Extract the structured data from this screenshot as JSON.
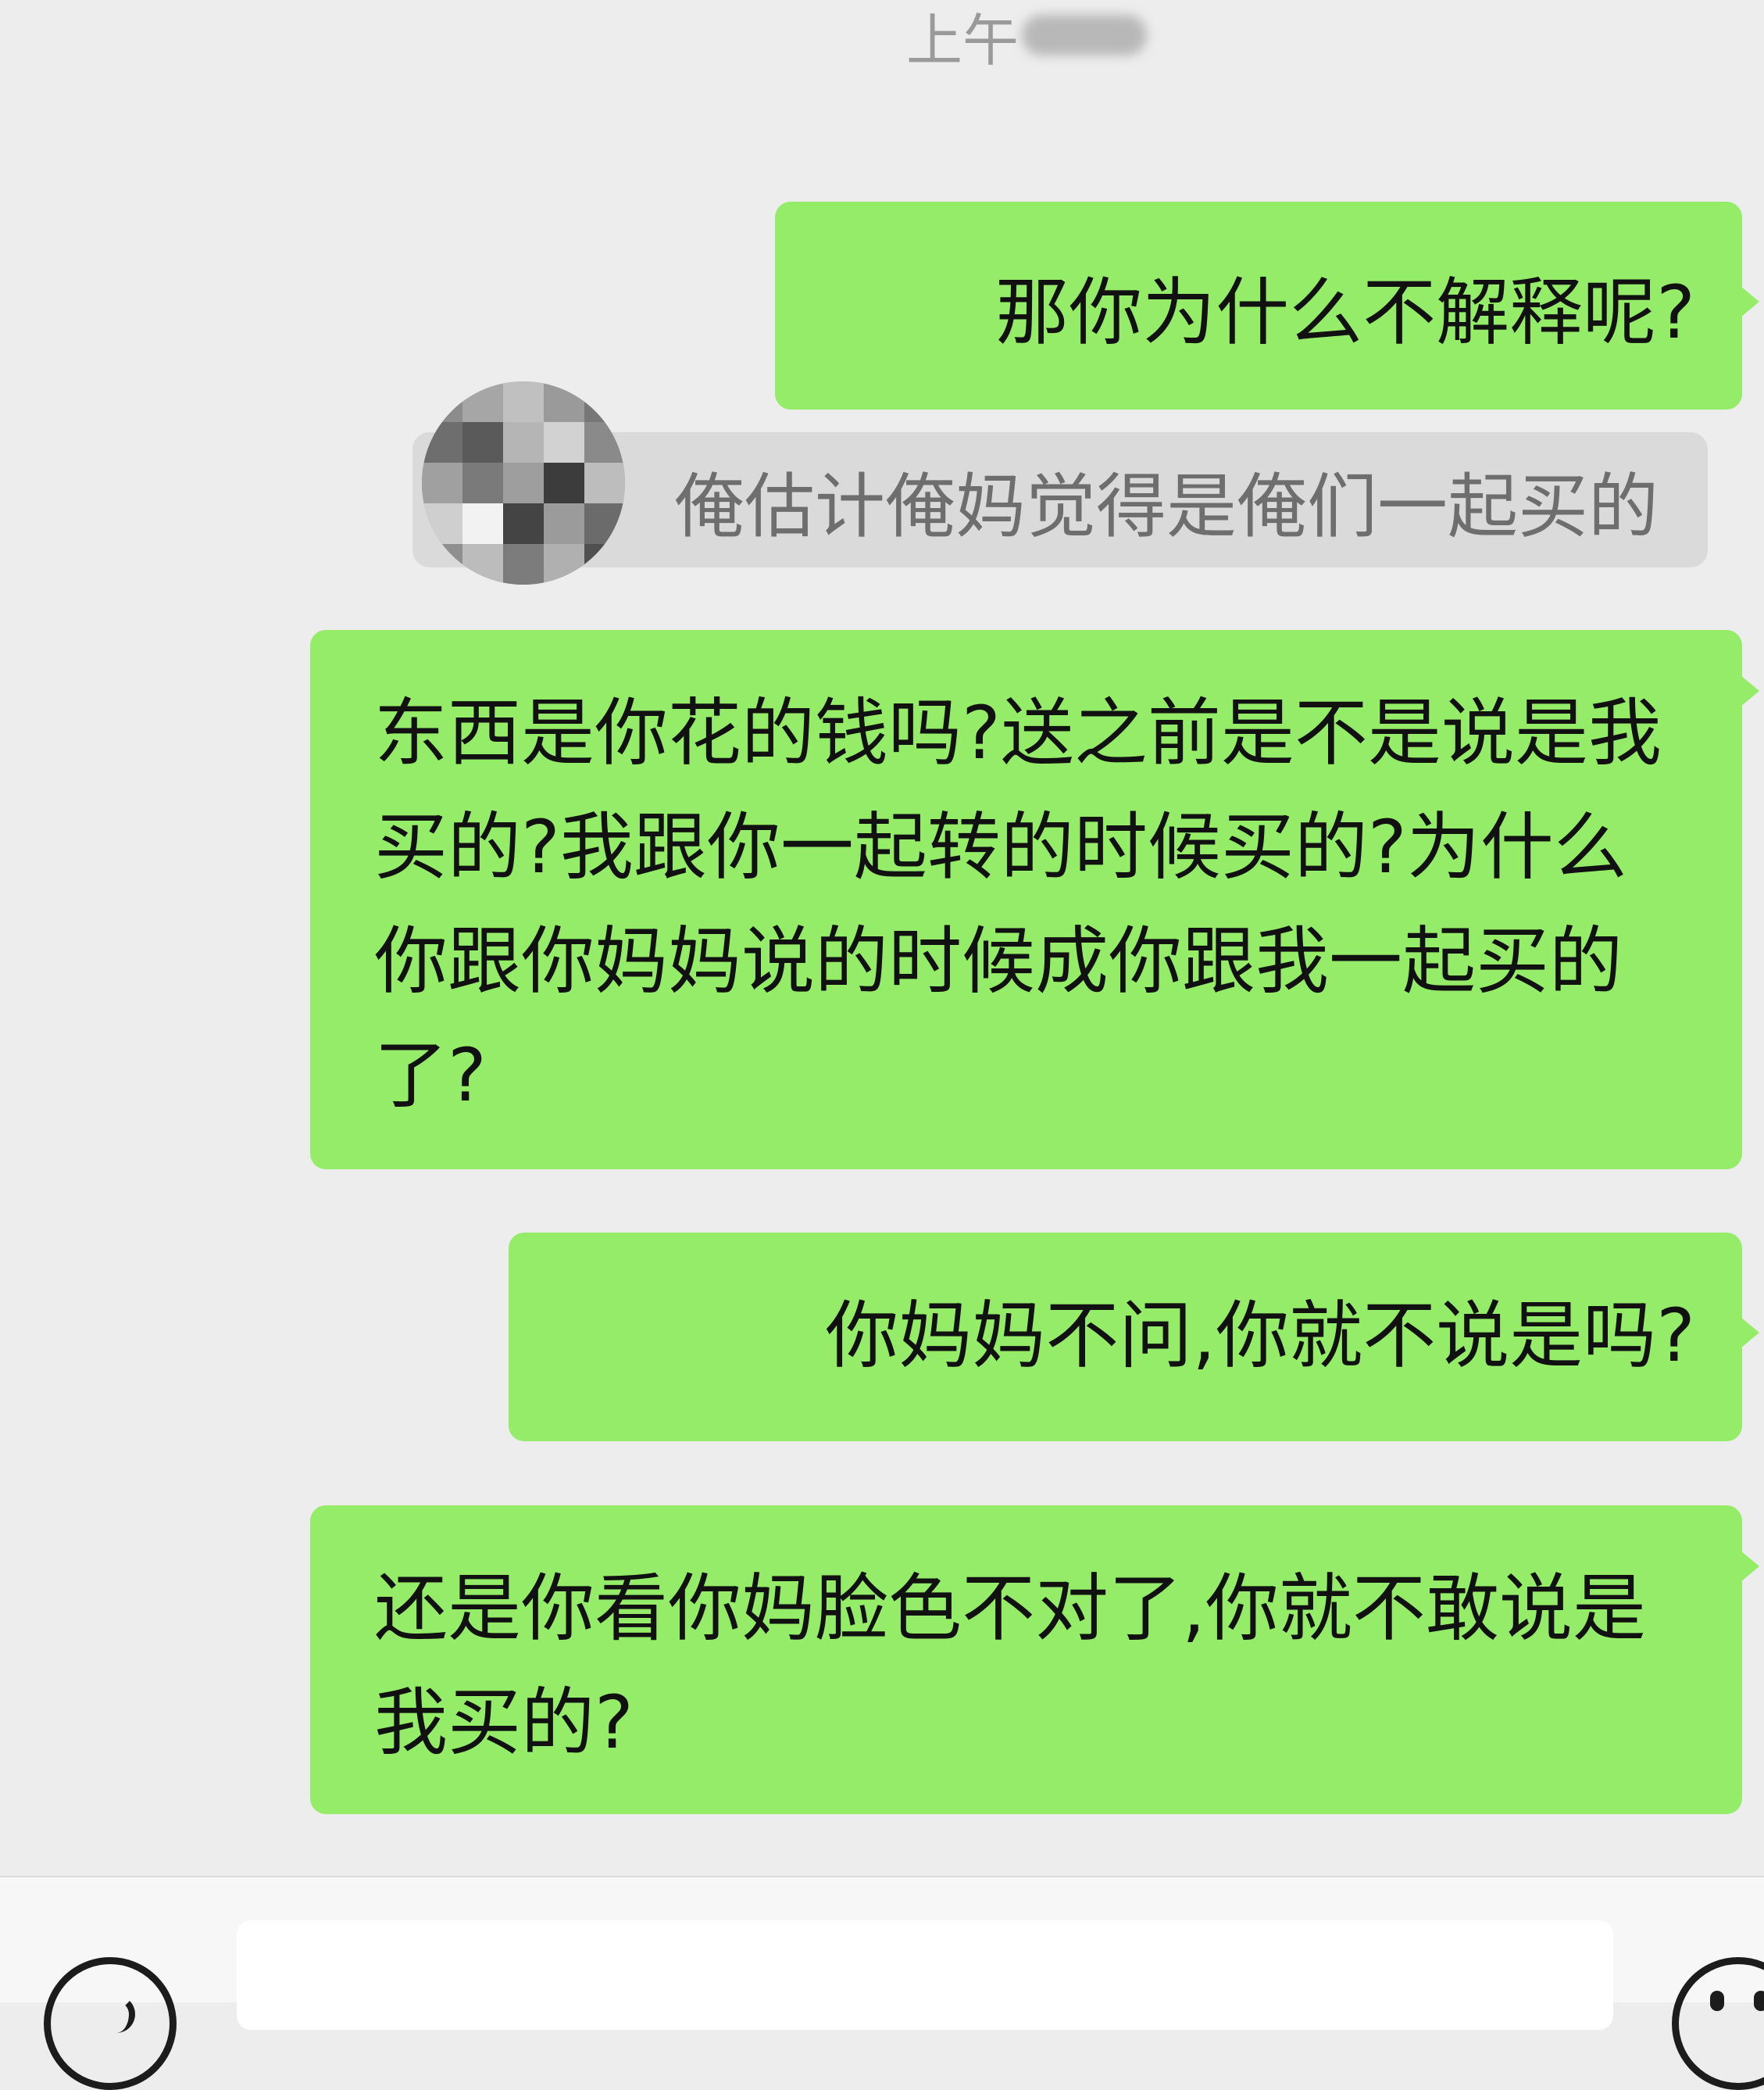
{
  "header": {
    "timestamp_label": "上午"
  },
  "messages": [
    {
      "id": "msg1",
      "sender": "self",
      "text": "那你为什么不解释呢?"
    },
    {
      "id": "msg3",
      "sender": "self",
      "text": "东西是你花的钱吗?送之前是不是说是我买的?我跟你一起转的时候买的?为什么你跟你妈妈说的时候成你跟我一起买的了?"
    },
    {
      "id": "msg4",
      "sender": "self",
      "text": "你妈妈不问,你就不说是吗?"
    },
    {
      "id": "msg5",
      "sender": "self",
      "text": "还是你看你妈脸色不对了,你就不敢说是我买的?"
    }
  ],
  "quote": {
    "text": "俺估计俺妈觉得是俺们一起买的"
  },
  "input_bar": {
    "voice_icon": "voice-icon",
    "emoji_icon": "emoji-icon",
    "input_value": ""
  },
  "colors": {
    "background": "#ededed",
    "bubble_self": "#95ec69",
    "quote_background": "#dadada",
    "timestamp_text": "#9a9a9a",
    "quote_text": "#6e6e6e"
  }
}
